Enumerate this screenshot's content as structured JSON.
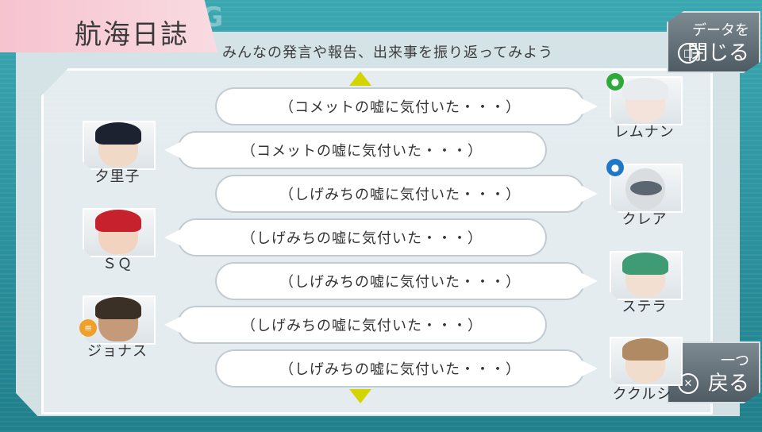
{
  "header": {
    "watermark": "LOG",
    "title": "航海日誌",
    "subtitle": "みんなの発言や報告、出来事を振り返ってみよう"
  },
  "buttons": {
    "close_data": {
      "top": "データを",
      "main": "閉じる",
      "glyph": "□"
    },
    "back": {
      "top": "一つ",
      "main": "戻る",
      "glyph": "✕"
    }
  },
  "left_characters": [
    {
      "name": "夕里子",
      "hair": "#1d2230",
      "skin": "#f1d9c8"
    },
    {
      "name": "ＳＱ",
      "hair": "#c7212d",
      "skin": "#f1d3c0"
    },
    {
      "name": "ジョナス",
      "hair": "#3b3026",
      "skin": "#c59a7b"
    }
  ],
  "right_characters": [
    {
      "name": "レムナン",
      "hair": "#e9ecef",
      "skin": "#f3e3da"
    },
    {
      "name": "クレア",
      "hair": "#5b6670",
      "skin": "#d9dde0"
    },
    {
      "name": "ステラ",
      "hair": "#3e9b73",
      "skin": "#f2dfd2"
    },
    {
      "name": "ククルシ",
      "hair": "#b08a62",
      "skin": "#f1ddcc"
    }
  ],
  "messages": [
    "（コメットの嘘に気付いた・・・）",
    "（コメットの嘘に気付いた・・・）",
    "（しげみちの嘘に気付いた・・・）",
    "（しげみちの嘘に気付いた・・・）",
    "（しげみちの嘘に気付いた・・・）",
    "（しげみちの嘘に気付いた・・・）",
    "（しげみちの嘘に気付いた・・・）"
  ],
  "chips": {
    "colors": {
      "green": "#2eaa3a",
      "blue": "#1f78c6",
      "orange": "#f0a028"
    }
  }
}
